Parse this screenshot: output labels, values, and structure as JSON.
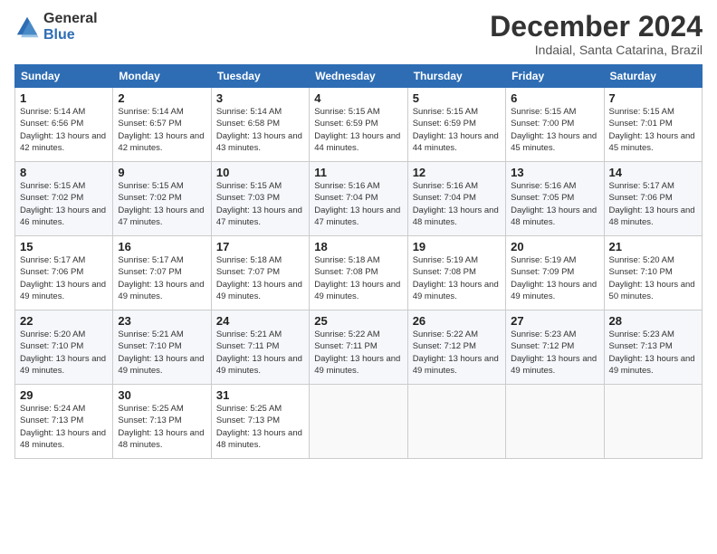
{
  "logo": {
    "general": "General",
    "blue": "Blue"
  },
  "title": "December 2024",
  "subtitle": "Indaial, Santa Catarina, Brazil",
  "weekdays": [
    "Sunday",
    "Monday",
    "Tuesday",
    "Wednesday",
    "Thursday",
    "Friday",
    "Saturday"
  ],
  "weeks": [
    [
      {
        "day": "1",
        "sunrise": "5:14 AM",
        "sunset": "6:56 PM",
        "daylight": "13 hours and 42 minutes."
      },
      {
        "day": "2",
        "sunrise": "5:14 AM",
        "sunset": "6:57 PM",
        "daylight": "13 hours and 42 minutes."
      },
      {
        "day": "3",
        "sunrise": "5:14 AM",
        "sunset": "6:58 PM",
        "daylight": "13 hours and 43 minutes."
      },
      {
        "day": "4",
        "sunrise": "5:15 AM",
        "sunset": "6:59 PM",
        "daylight": "13 hours and 44 minutes."
      },
      {
        "day": "5",
        "sunrise": "5:15 AM",
        "sunset": "6:59 PM",
        "daylight": "13 hours and 44 minutes."
      },
      {
        "day": "6",
        "sunrise": "5:15 AM",
        "sunset": "7:00 PM",
        "daylight": "13 hours and 45 minutes."
      },
      {
        "day": "7",
        "sunrise": "5:15 AM",
        "sunset": "7:01 PM",
        "daylight": "13 hours and 45 minutes."
      }
    ],
    [
      {
        "day": "8",
        "sunrise": "5:15 AM",
        "sunset": "7:02 PM",
        "daylight": "13 hours and 46 minutes."
      },
      {
        "day": "9",
        "sunrise": "5:15 AM",
        "sunset": "7:02 PM",
        "daylight": "13 hours and 47 minutes."
      },
      {
        "day": "10",
        "sunrise": "5:15 AM",
        "sunset": "7:03 PM",
        "daylight": "13 hours and 47 minutes."
      },
      {
        "day": "11",
        "sunrise": "5:16 AM",
        "sunset": "7:04 PM",
        "daylight": "13 hours and 47 minutes."
      },
      {
        "day": "12",
        "sunrise": "5:16 AM",
        "sunset": "7:04 PM",
        "daylight": "13 hours and 48 minutes."
      },
      {
        "day": "13",
        "sunrise": "5:16 AM",
        "sunset": "7:05 PM",
        "daylight": "13 hours and 48 minutes."
      },
      {
        "day": "14",
        "sunrise": "5:17 AM",
        "sunset": "7:06 PM",
        "daylight": "13 hours and 48 minutes."
      }
    ],
    [
      {
        "day": "15",
        "sunrise": "5:17 AM",
        "sunset": "7:06 PM",
        "daylight": "13 hours and 49 minutes."
      },
      {
        "day": "16",
        "sunrise": "5:17 AM",
        "sunset": "7:07 PM",
        "daylight": "13 hours and 49 minutes."
      },
      {
        "day": "17",
        "sunrise": "5:18 AM",
        "sunset": "7:07 PM",
        "daylight": "13 hours and 49 minutes."
      },
      {
        "day": "18",
        "sunrise": "5:18 AM",
        "sunset": "7:08 PM",
        "daylight": "13 hours and 49 minutes."
      },
      {
        "day": "19",
        "sunrise": "5:19 AM",
        "sunset": "7:08 PM",
        "daylight": "13 hours and 49 minutes."
      },
      {
        "day": "20",
        "sunrise": "5:19 AM",
        "sunset": "7:09 PM",
        "daylight": "13 hours and 49 minutes."
      },
      {
        "day": "21",
        "sunrise": "5:20 AM",
        "sunset": "7:10 PM",
        "daylight": "13 hours and 50 minutes."
      }
    ],
    [
      {
        "day": "22",
        "sunrise": "5:20 AM",
        "sunset": "7:10 PM",
        "daylight": "13 hours and 49 minutes."
      },
      {
        "day": "23",
        "sunrise": "5:21 AM",
        "sunset": "7:10 PM",
        "daylight": "13 hours and 49 minutes."
      },
      {
        "day": "24",
        "sunrise": "5:21 AM",
        "sunset": "7:11 PM",
        "daylight": "13 hours and 49 minutes."
      },
      {
        "day": "25",
        "sunrise": "5:22 AM",
        "sunset": "7:11 PM",
        "daylight": "13 hours and 49 minutes."
      },
      {
        "day": "26",
        "sunrise": "5:22 AM",
        "sunset": "7:12 PM",
        "daylight": "13 hours and 49 minutes."
      },
      {
        "day": "27",
        "sunrise": "5:23 AM",
        "sunset": "7:12 PM",
        "daylight": "13 hours and 49 minutes."
      },
      {
        "day": "28",
        "sunrise": "5:23 AM",
        "sunset": "7:13 PM",
        "daylight": "13 hours and 49 minutes."
      }
    ],
    [
      {
        "day": "29",
        "sunrise": "5:24 AM",
        "sunset": "7:13 PM",
        "daylight": "13 hours and 48 minutes."
      },
      {
        "day": "30",
        "sunrise": "5:25 AM",
        "sunset": "7:13 PM",
        "daylight": "13 hours and 48 minutes."
      },
      {
        "day": "31",
        "sunrise": "5:25 AM",
        "sunset": "7:13 PM",
        "daylight": "13 hours and 48 minutes."
      },
      null,
      null,
      null,
      null
    ]
  ]
}
